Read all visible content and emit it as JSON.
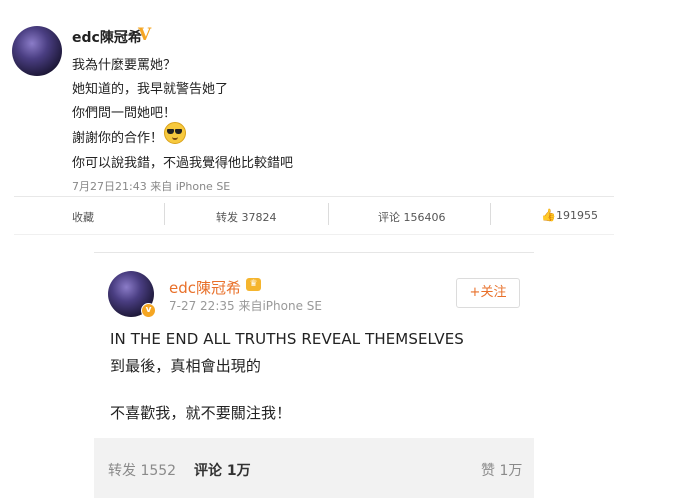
{
  "top_post": {
    "username": "edc陳冠希",
    "badge": "V",
    "lines": [
      "我為什麼要罵她？",
      "她知道的，我早就警告她了",
      "你們問一問她吧！",
      "謝謝你的合作！",
      "你可以說我錯，不過我覺得他比較錯吧"
    ],
    "meta": "7月27日21:43 来自 iPhone SE",
    "actions": {
      "favorite": "收藏",
      "repost": "转发 37824",
      "comment": "评论 156406",
      "like": "191955"
    }
  },
  "quoted_post": {
    "username": "edc陳冠希",
    "meta": "7-27 22:35  来自iPhone SE",
    "follow_label": "+关注",
    "lines": [
      "IN THE END ALL TRUTHS REVEAL THEMSELVES",
      "到最後，真相會出現的",
      "不喜歡我，就不要關注我！"
    ],
    "footer": {
      "repost": "转发 1552",
      "comment": "评论 1万",
      "like": "赞 1万"
    }
  }
}
